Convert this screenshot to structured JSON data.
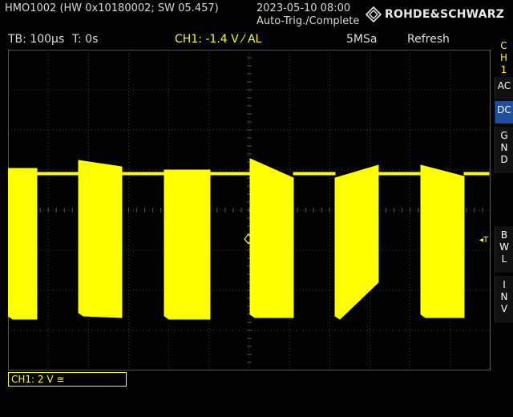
{
  "header": {
    "device_info": "HMO1002 (HW 0x10180002; SW 05.457)",
    "datetime": "2023-05-10 08:00",
    "status": "Auto-Trig./Complete",
    "brand": "ROHDE&SCHWARZ"
  },
  "info_bar": {
    "timebase": "TB: 100µs",
    "trigger_time": "T: 0s",
    "ch1_trigger": "CH1: -1.4 V ⁄ AL",
    "sample_rate": "5MSa",
    "acq_mode": "Refresh"
  },
  "side_menu": {
    "channel": [
      "C",
      "H",
      "1"
    ],
    "items": [
      {
        "label": [
          "A",
          "C"
        ],
        "active": false
      },
      {
        "label": [
          "D",
          "C"
        ],
        "active": true
      },
      {
        "label": [
          "G",
          "N",
          "D"
        ],
        "active": false
      },
      {
        "label": [
          "B",
          "W",
          "L"
        ],
        "active": false
      },
      {
        "label": [
          "I",
          "N",
          "V"
        ],
        "active": false
      }
    ]
  },
  "markers": {
    "ch1_marker": "1",
    "trigger_marker": "◂T"
  },
  "channel_box": {
    "label": "CH1: 2 V ≅"
  },
  "colors": {
    "trace": "#ffff00",
    "grid": "#3c3c3c",
    "active_key": "#1e4fa0"
  },
  "icons": {
    "brand_logo": "rohde-schwarz-diamond-icon",
    "trigger_position": "diamond-icon"
  }
}
